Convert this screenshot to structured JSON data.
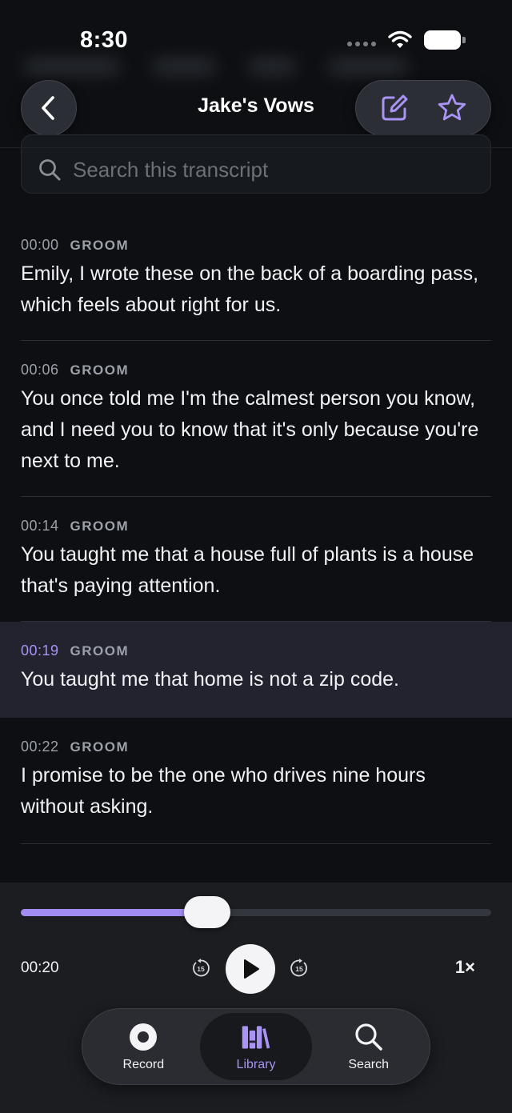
{
  "status_bar": {
    "time": "8:30"
  },
  "header": {
    "title": "Jake's Vows"
  },
  "search": {
    "placeholder": "Search this transcript"
  },
  "transcript": [
    {
      "time": "00:00",
      "speaker": "GROOM",
      "text": "Emily, I wrote these on the back of a boarding pass, which feels about right for us."
    },
    {
      "time": "00:06",
      "speaker": "GROOM",
      "text": "You once told me I'm the calmest person you know, and I need you to know that it's only because you're next to me."
    },
    {
      "time": "00:14",
      "speaker": "GROOM",
      "text": "You taught me that a house full of plants is a house that's paying attention."
    },
    {
      "time": "00:19",
      "speaker": "GROOM",
      "text": "You taught me that home is not a zip code.",
      "active": true
    },
    {
      "time": "00:22",
      "speaker": "GROOM",
      "text": "I promise to be the one who drives nine hours without asking."
    }
  ],
  "player": {
    "elapsed": "00:20",
    "progress_fraction": 0.396,
    "skip_back_label": "15",
    "skip_forward_label": "15",
    "speed": "1×"
  },
  "tabs": [
    {
      "id": "record",
      "label": "Record",
      "icon": "record-icon"
    },
    {
      "id": "library",
      "label": "Library",
      "icon": "library-icon",
      "active": true
    },
    {
      "id": "search",
      "label": "Search",
      "icon": "search-icon"
    }
  ],
  "colors": {
    "accent": "#a993f5",
    "background": "#0d0f12",
    "active_row": "#22232f"
  }
}
